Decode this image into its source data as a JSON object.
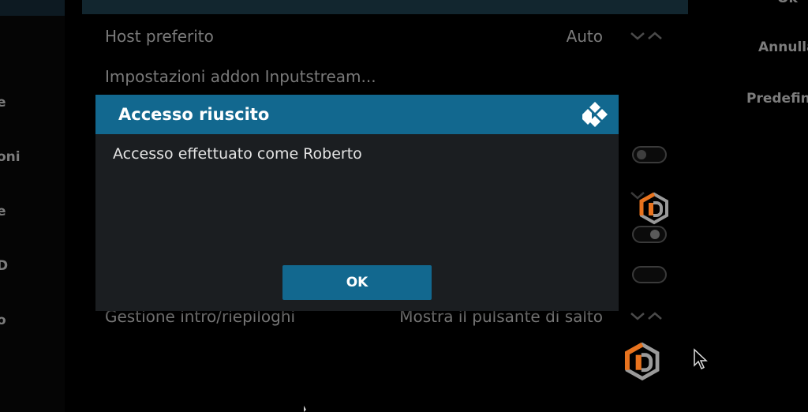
{
  "left_sidebar": {
    "items": [
      "e",
      "oni",
      "e",
      "D",
      "o"
    ]
  },
  "settings": {
    "rows": [
      {
        "label": "Host preferito",
        "value": "Auto"
      },
      {
        "label": "Impostazioni addon Inputstream...",
        "value": ""
      },
      {
        "label": "Gestione intro/riepiloghi",
        "value": "Mostra il pulsante di salto"
      }
    ]
  },
  "right_sidebar": {
    "items": [
      "Ok",
      "Annulla",
      "Predefinito"
    ]
  },
  "dialog": {
    "title": "Accesso riuscito",
    "message": "Accesso effettuato come Roberto",
    "ok_label": "OK"
  },
  "icons": {
    "kodi": "kodi-logo-icon",
    "addon": "addon-hex-icon",
    "pointer": "mouse-pointer-icon"
  },
  "colors": {
    "accent": "#12688f",
    "dialog_bg": "#1b1e21",
    "addon_orange": "#e8731e",
    "addon_grey": "#9a9a9a"
  }
}
